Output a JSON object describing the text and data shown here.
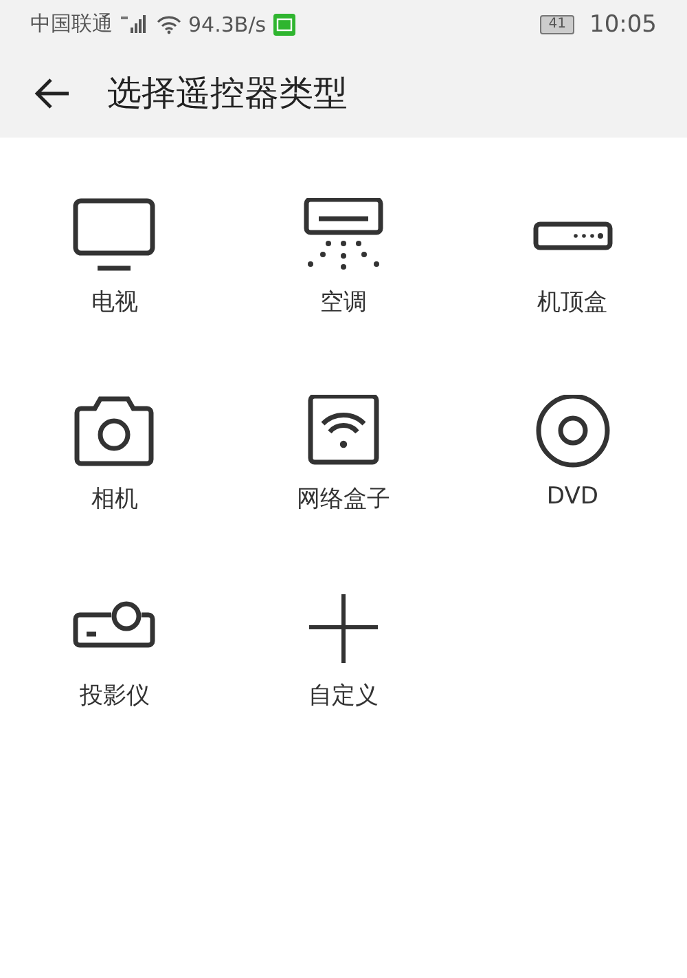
{
  "status_bar": {
    "carrier": "中国联通",
    "network_speed": "94.3B/s",
    "battery": "41",
    "time": "10:05"
  },
  "header": {
    "title": "选择遥控器类型"
  },
  "device_types": [
    {
      "kind": "tv",
      "label": "电视"
    },
    {
      "kind": "ac",
      "label": "空调"
    },
    {
      "kind": "settop",
      "label": "机顶盒"
    },
    {
      "kind": "camera",
      "label": "相机"
    },
    {
      "kind": "netbox",
      "label": "网络盒子"
    },
    {
      "kind": "dvd",
      "label": "DVD"
    },
    {
      "kind": "projector",
      "label": "投影仪"
    },
    {
      "kind": "custom",
      "label": "自定义"
    }
  ]
}
